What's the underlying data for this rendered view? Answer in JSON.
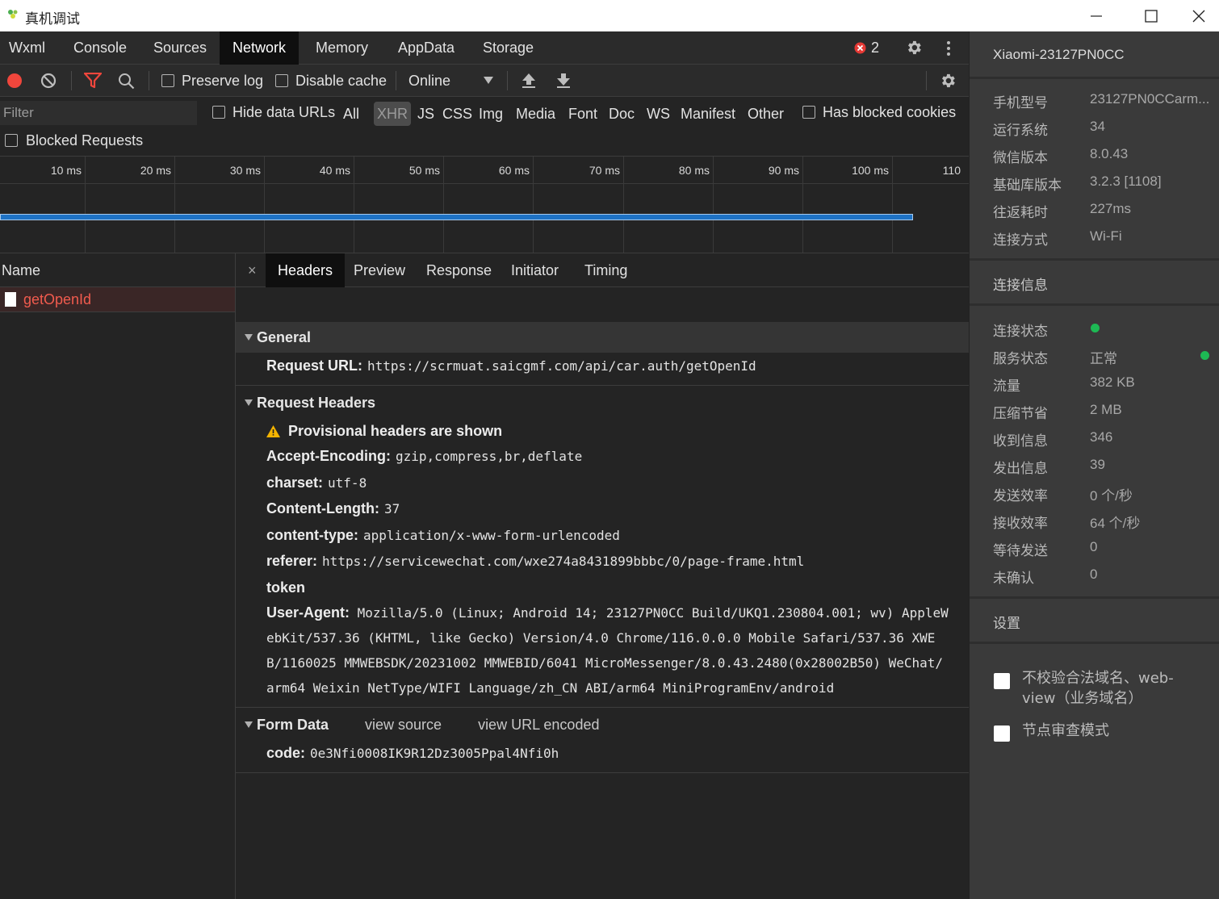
{
  "window": {
    "title": "真机调试"
  },
  "tabs": [
    "Wxml",
    "Console",
    "Sources",
    "Network",
    "Memory",
    "AppData",
    "Storage"
  ],
  "active_tab": "Network",
  "error_count": "2",
  "toolbar": {
    "preserve_log": "Preserve log",
    "disable_cache": "Disable cache",
    "throttling": "Online"
  },
  "filter": {
    "placeholder": "Filter",
    "hide_data_urls": "Hide data URLs",
    "types": [
      "All",
      "XHR",
      "JS",
      "CSS",
      "Img",
      "Media",
      "Font",
      "Doc",
      "WS",
      "Manifest",
      "Other"
    ],
    "selected_type": "XHR",
    "has_blocked_cookies": "Has blocked cookies",
    "blocked_requests": "Blocked Requests"
  },
  "timeline": {
    "ticks": [
      "10 ms",
      "20 ms",
      "30 ms",
      "40 ms",
      "50 ms",
      "60 ms",
      "70 ms",
      "80 ms",
      "90 ms",
      "100 ms",
      "110"
    ]
  },
  "requests": {
    "header": "Name",
    "items": [
      {
        "name": "getOpenId"
      }
    ]
  },
  "detail": {
    "close": "×",
    "tabs": [
      "Headers",
      "Preview",
      "Response",
      "Initiator",
      "Timing"
    ],
    "general": {
      "title": "General",
      "request_url_key": "Request URL:",
      "request_url": "https://scrmuat.saicgmf.com/api/car.auth/getOpenId"
    },
    "request_headers": {
      "title": "Request Headers",
      "warning": "Provisional headers are shown",
      "accept_encoding_key": "Accept-Encoding:",
      "accept_encoding": "gzip,compress,br,deflate",
      "charset_key": "charset:",
      "charset": "utf-8",
      "content_length_key": "Content-Length:",
      "content_length": "37",
      "content_type_key": "content-type:",
      "content_type": "application/x-www-form-urlencoded",
      "referer_key": "referer:",
      "referer": "https://servicewechat.com/wxe274a8431899bbbc/0/page-frame.html",
      "token_key": "token",
      "user_agent_key": "User-Agent:",
      "user_agent_line1": "Mozilla/5.0 (Linux; Android 14; 23127PN0CC Build/UKQ1.230804.001; wv) AppleW",
      "user_agent_line2": "ebKit/537.36 (KHTML, like Gecko) Version/4.0 Chrome/116.0.0.0 Mobile Safari/537.36 XWE",
      "user_agent_line3": "B/1160025 MMWEBSDK/20231002 MMWEBID/6041 MicroMessenger/8.0.43.2480(0x28002B50) WeChat/",
      "user_agent_line4": "arm64 Weixin NetType/WIFI Language/zh_CN ABI/arm64 MiniProgramEnv/android"
    },
    "form_data": {
      "title": "Form Data",
      "view_source": "view source",
      "view_url_encoded": "view URL encoded",
      "code_key": "code:",
      "code": "0e3Nfi0008IK9R12Dz3005Ppal4Nfi0h"
    }
  },
  "right_panel": {
    "device": "Xiaomi-23127PN0CC",
    "info": [
      {
        "label": "手机型号",
        "value": "23127PN0CCarm..."
      },
      {
        "label": "运行系统",
        "value": "34"
      },
      {
        "label": "微信版本",
        "value": "8.0.43"
      },
      {
        "label": "基础库版本",
        "value": "3.2.3 [1108]"
      },
      {
        "label": "往返耗时",
        "value": "227ms"
      },
      {
        "label": "连接方式",
        "value": "Wi-Fi"
      }
    ],
    "connection_title": "连接信息",
    "connection": [
      {
        "label": "连接状态",
        "value": ""
      },
      {
        "label": "服务状态",
        "value": "正常"
      },
      {
        "label": "流量",
        "value": "382 KB"
      },
      {
        "label": "压缩节省",
        "value": "2 MB"
      },
      {
        "label": "收到信息",
        "value": "346"
      },
      {
        "label": "发出信息",
        "value": "39"
      },
      {
        "label": "发送效率",
        "value": "0 个/秒"
      },
      {
        "label": "接收效率",
        "value": "64 个/秒"
      },
      {
        "label": "等待发送",
        "value": "0"
      },
      {
        "label": "未确认",
        "value": "0"
      }
    ],
    "settings_title": "设置",
    "settings": [
      {
        "label": "不校验合法域名、web-view（业务域名）"
      },
      {
        "label": "节点审查模式"
      }
    ],
    "colors": {
      "status_green": "#1db954",
      "error_red": "#e53935"
    }
  }
}
